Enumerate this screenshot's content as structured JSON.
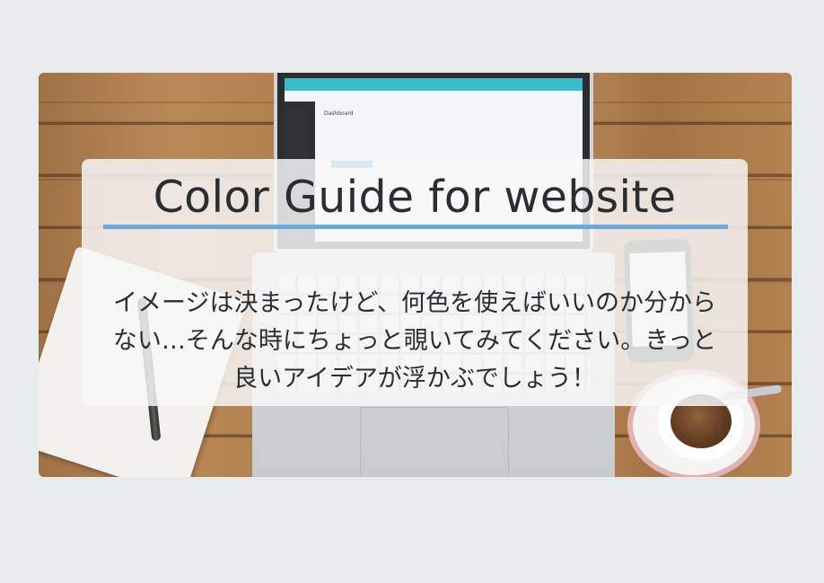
{
  "hero": {
    "title": "Color Guide for website",
    "description": "イメージは決まったけど、何色を使えばいいのか分からない…そんな時にちょっと覗いてみてください。きっと良いアイデアが浮かぶでしょう！",
    "screen_heading": "Dashboard"
  },
  "colors": {
    "page_background": "#e8ebee",
    "title_text": "#2a2e33",
    "title_underline": "#6aa9db",
    "card_background": "#f8f8f8"
  }
}
